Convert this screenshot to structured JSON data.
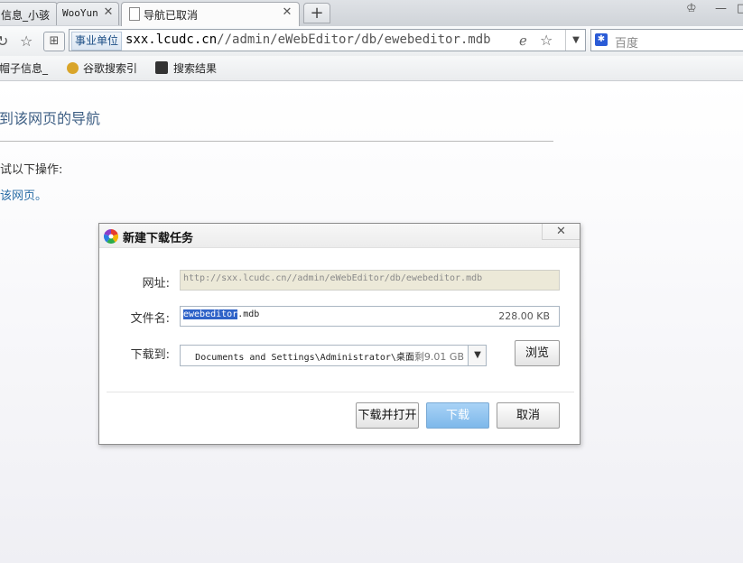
{
  "browser": {
    "tabs": [
      {
        "label": "信息_小骇"
      },
      {
        "label": "WooYun"
      },
      {
        "label": "导航已取消"
      }
    ],
    "address": {
      "site_tag": "事业单位",
      "url_host": "sxx.lcudc.cn",
      "url_path": "//admin/eWebEditor/db/ewebeditor.mdb"
    },
    "search": {
      "placeholder": "百度"
    },
    "bookmarks": [
      {
        "label": "帽子信息_"
      },
      {
        "label": "谷歌搜索引"
      },
      {
        "label": "搜索结果"
      }
    ]
  },
  "page": {
    "title": "到该网页的导航",
    "try_text": "试以下操作:",
    "link_text": "该网页。"
  },
  "dialog": {
    "title": "新建下载任务",
    "url_label": "网址:",
    "url_value": "http://sxx.lcudc.cn//admin/eWebEditor/db/ewebeditor.mdb",
    "filename_label": "文件名:",
    "filename_selected": "ewebeditor",
    "filename_ext": ".mdb",
    "file_size": "228.00 KB",
    "saveto_label": "下载到:",
    "saveto_path": "Documents and Settings\\Administrator\\桌面",
    "free_space": "剩9.01 GB",
    "browse_label": "浏览",
    "download_open_label": "下载并打开",
    "download_label": "下载",
    "cancel_label": "取消"
  },
  "colors": {
    "accent": "#2f63c8",
    "primary_button": "#7db8ea"
  }
}
